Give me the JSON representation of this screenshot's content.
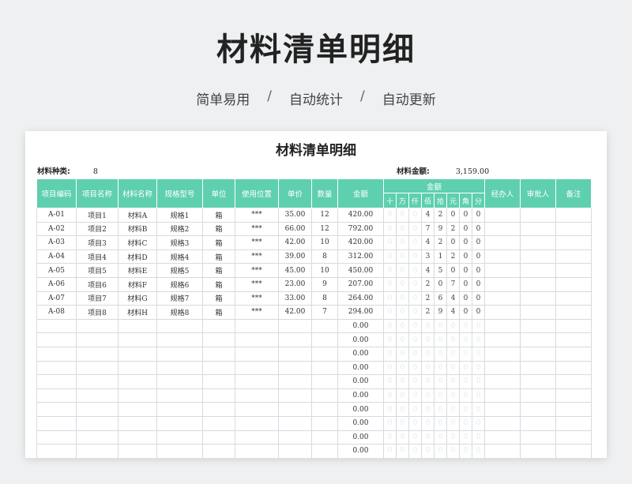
{
  "header": {
    "title": "材料清单明细",
    "tags": [
      "简单易用",
      "自动统计",
      "自动更新"
    ],
    "separator": "/"
  },
  "sheet": {
    "title": "材料清单明细",
    "kinds_label": "材料种类:",
    "kinds_value": "8",
    "amount_label": "材料金额:",
    "amount_value": "3,159.00",
    "columns": [
      "项目编码",
      "项目名称",
      "材料名称",
      "规格型号",
      "单位",
      "使用位置",
      "单价",
      "数量",
      "金额",
      "金额",
      "经办人",
      "审批人",
      "备注"
    ],
    "digit_columns": [
      "十",
      "万",
      "仟",
      "佰",
      "拾",
      "元",
      "角",
      "分"
    ],
    "rows": [
      {
        "code": "A-01",
        "project": "项目1",
        "material": "材料A",
        "spec": "规格1",
        "unit": "箱",
        "location": "***",
        "price": "35.00",
        "qty": "12",
        "amount": "420.00",
        "digits": [
          "0",
          "0",
          "0",
          "4",
          "2",
          "0",
          "0",
          "0"
        ]
      },
      {
        "code": "A-02",
        "project": "项目2",
        "material": "材料B",
        "spec": "规格2",
        "unit": "箱",
        "location": "***",
        "price": "66.00",
        "qty": "12",
        "amount": "792.00",
        "digits": [
          "0",
          "0",
          "0",
          "7",
          "9",
          "2",
          "0",
          "0"
        ]
      },
      {
        "code": "A-03",
        "project": "项目3",
        "material": "材料C",
        "spec": "规格3",
        "unit": "箱",
        "location": "***",
        "price": "42.00",
        "qty": "10",
        "amount": "420.00",
        "digits": [
          "0",
          "0",
          "0",
          "4",
          "2",
          "0",
          "0",
          "0"
        ]
      },
      {
        "code": "A-04",
        "project": "项目4",
        "material": "材料D",
        "spec": "规格4",
        "unit": "箱",
        "location": "***",
        "price": "39.00",
        "qty": "8",
        "amount": "312.00",
        "digits": [
          "0",
          "0",
          "0",
          "3",
          "1",
          "2",
          "0",
          "0"
        ]
      },
      {
        "code": "A-05",
        "project": "项目5",
        "material": "材料E",
        "spec": "规格5",
        "unit": "箱",
        "location": "***",
        "price": "45.00",
        "qty": "10",
        "amount": "450.00",
        "digits": [
          "0",
          "0",
          "0",
          "4",
          "5",
          "0",
          "0",
          "0"
        ]
      },
      {
        "code": "A-06",
        "project": "项目6",
        "material": "材料F",
        "spec": "规格6",
        "unit": "箱",
        "location": "***",
        "price": "23.00",
        "qty": "9",
        "amount": "207.00",
        "digits": [
          "0",
          "0",
          "0",
          "2",
          "0",
          "7",
          "0",
          "0"
        ]
      },
      {
        "code": "A-07",
        "project": "项目7",
        "material": "材料G",
        "spec": "规格7",
        "unit": "箱",
        "location": "***",
        "price": "33.00",
        "qty": "8",
        "amount": "264.00",
        "digits": [
          "0",
          "0",
          "0",
          "2",
          "6",
          "4",
          "0",
          "0"
        ]
      },
      {
        "code": "A-08",
        "project": "项目8",
        "material": "材料H",
        "spec": "规格8",
        "unit": "箱",
        "location": "***",
        "price": "42.00",
        "qty": "7",
        "amount": "294.00",
        "digits": [
          "0",
          "0",
          "0",
          "2",
          "9",
          "4",
          "0",
          "0"
        ]
      },
      {
        "code": "",
        "project": "",
        "material": "",
        "spec": "",
        "unit": "",
        "location": "",
        "price": "",
        "qty": "",
        "amount": "0.00",
        "digits": [
          "0",
          "0",
          "0",
          "0",
          "0",
          "0",
          "0",
          "0"
        ]
      },
      {
        "code": "",
        "project": "",
        "material": "",
        "spec": "",
        "unit": "",
        "location": "",
        "price": "",
        "qty": "",
        "amount": "0.00",
        "digits": [
          "0",
          "0",
          "0",
          "0",
          "0",
          "0",
          "0",
          "0"
        ]
      },
      {
        "code": "",
        "project": "",
        "material": "",
        "spec": "",
        "unit": "",
        "location": "",
        "price": "",
        "qty": "",
        "amount": "0.00",
        "digits": [
          "0",
          "0",
          "0",
          "0",
          "0",
          "0",
          "0",
          "0"
        ]
      },
      {
        "code": "",
        "project": "",
        "material": "",
        "spec": "",
        "unit": "",
        "location": "",
        "price": "",
        "qty": "",
        "amount": "0.00",
        "digits": [
          "0",
          "0",
          "0",
          "0",
          "0",
          "0",
          "0",
          "0"
        ]
      },
      {
        "code": "",
        "project": "",
        "material": "",
        "spec": "",
        "unit": "",
        "location": "",
        "price": "",
        "qty": "",
        "amount": "0.00",
        "digits": [
          "0",
          "0",
          "0",
          "0",
          "0",
          "0",
          "0",
          "0"
        ]
      },
      {
        "code": "",
        "project": "",
        "material": "",
        "spec": "",
        "unit": "",
        "location": "",
        "price": "",
        "qty": "",
        "amount": "0.00",
        "digits": [
          "0",
          "0",
          "0",
          "0",
          "0",
          "0",
          "0",
          "0"
        ]
      },
      {
        "code": "",
        "project": "",
        "material": "",
        "spec": "",
        "unit": "",
        "location": "",
        "price": "",
        "qty": "",
        "amount": "0.00",
        "digits": [
          "0",
          "0",
          "0",
          "0",
          "0",
          "0",
          "0",
          "0"
        ]
      },
      {
        "code": "",
        "project": "",
        "material": "",
        "spec": "",
        "unit": "",
        "location": "",
        "price": "",
        "qty": "",
        "amount": "0.00",
        "digits": [
          "0",
          "0",
          "0",
          "0",
          "0",
          "0",
          "0",
          "0"
        ]
      },
      {
        "code": "",
        "project": "",
        "material": "",
        "spec": "",
        "unit": "",
        "location": "",
        "price": "",
        "qty": "",
        "amount": "0.00",
        "digits": [
          "0",
          "0",
          "0",
          "0",
          "0",
          "0",
          "0",
          "0"
        ]
      },
      {
        "code": "",
        "project": "",
        "material": "",
        "spec": "",
        "unit": "",
        "location": "",
        "price": "",
        "qty": "",
        "amount": "0.00",
        "digits": [
          "0",
          "0",
          "0",
          "0",
          "0",
          "0",
          "0",
          "0"
        ]
      }
    ]
  }
}
